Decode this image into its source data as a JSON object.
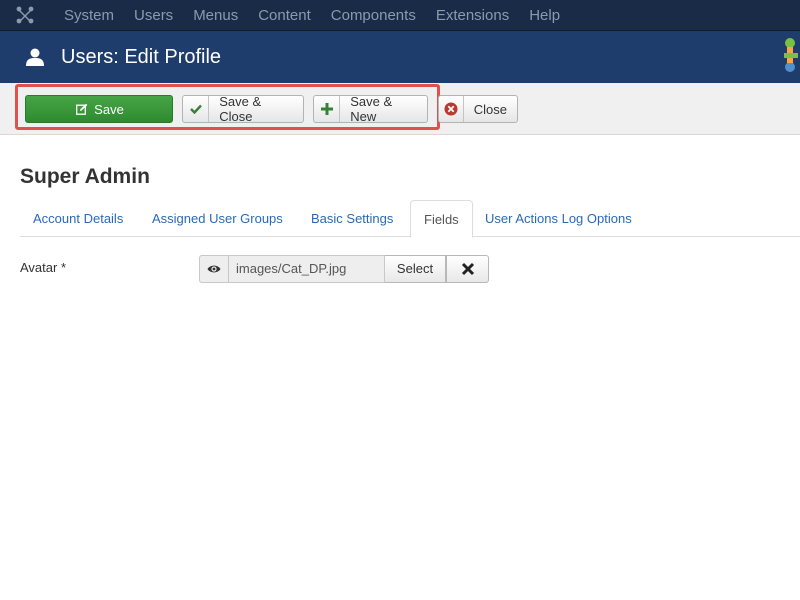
{
  "topnav": {
    "items": [
      {
        "label": "System"
      },
      {
        "label": "Users"
      },
      {
        "label": "Menus"
      },
      {
        "label": "Content"
      },
      {
        "label": "Components"
      },
      {
        "label": "Extensions"
      },
      {
        "label": "Help"
      }
    ]
  },
  "header": {
    "title": "Users: Edit Profile",
    "icon": "user-icon"
  },
  "toolbar": {
    "save_label": "Save",
    "save_close_label": "Save & Close",
    "save_new_label": "Save & New",
    "close_label": "Close"
  },
  "page": {
    "title": "Super Admin"
  },
  "tabs": [
    {
      "label": "Account Details",
      "active": false
    },
    {
      "label": "Assigned User Groups",
      "active": false
    },
    {
      "label": "Basic Settings",
      "active": false
    },
    {
      "label": "Fields",
      "active": true
    },
    {
      "label": "User Actions Log Options",
      "active": false
    }
  ],
  "fields": {
    "avatar": {
      "label": "Avatar *",
      "value": "images/Cat_DP.jpg",
      "select_label": "Select"
    }
  },
  "colors": {
    "nav_bg": "#1a2b47",
    "header_bg": "#1e3c6c",
    "save_green": "#46a546",
    "highlight_red": "#e0504c",
    "link_blue": "#2a69b8"
  }
}
